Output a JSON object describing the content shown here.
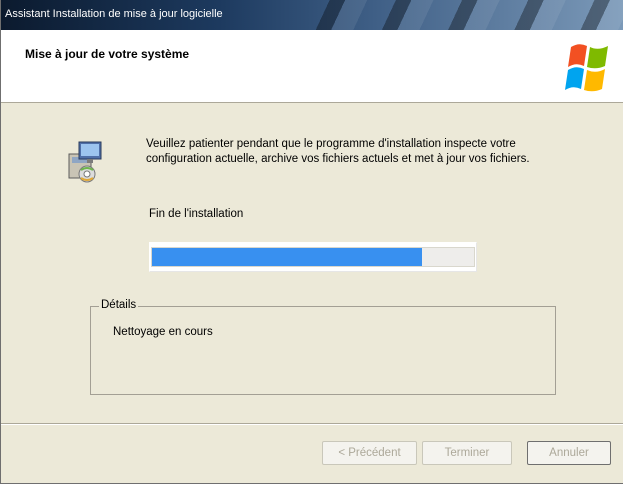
{
  "window": {
    "title": "Assistant Installation de mise à jour logicielle"
  },
  "header": {
    "title": "Mise à jour de votre système",
    "logo_icon": "windows-flag-icon"
  },
  "main": {
    "app_icon": "installer-package-icon",
    "description": "Veuillez patienter pendant que le programme d'installation inspecte votre configuration actuelle, archive vos fichiers actuels et met à jour vos fichiers.",
    "status_label": "Fin de l'installation",
    "progress_fraction": 0.84
  },
  "details": {
    "legend": "Détails",
    "text": "Nettoyage en cours"
  },
  "buttons": {
    "previous_label": "< Précédent",
    "finish_label": "Terminer",
    "cancel_label": "Annuler"
  },
  "colors": {
    "progress_fill": "#3890f0",
    "titlebar_start": "#0b1a2e",
    "dialog_background": "#ece9d8"
  }
}
